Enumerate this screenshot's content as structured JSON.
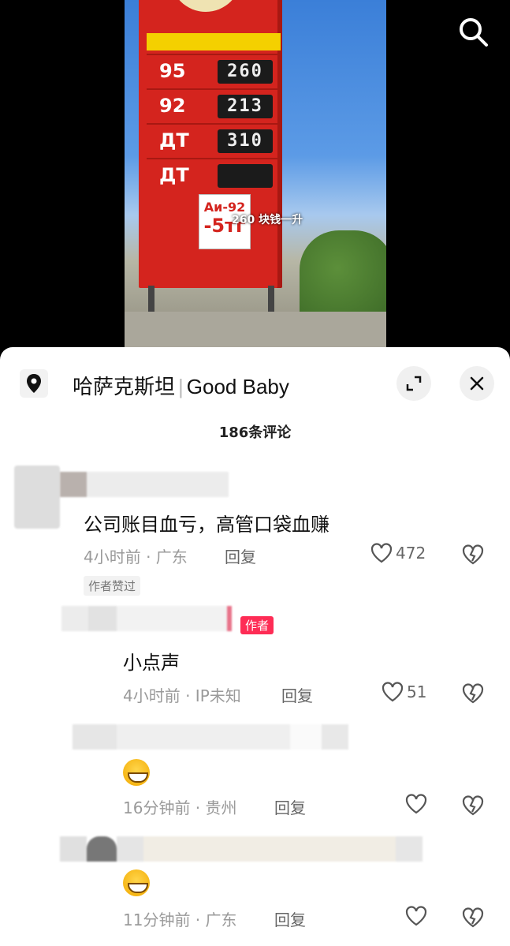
{
  "video": {
    "fuel_rows": [
      {
        "grade": "95",
        "price": "260"
      },
      {
        "grade": "92",
        "price": "213"
      },
      {
        "grade": "ДТ",
        "price": "310"
      },
      {
        "grade": "ДТ",
        "price": ""
      }
    ],
    "sign_line1": "Аи-92",
    "sign_line2": "-5тг",
    "caption": "260 块钱一升"
  },
  "header": {
    "location": "哈萨克斯坦",
    "music": "Good Baby",
    "comment_count": "186条评论"
  },
  "comments": [
    {
      "text": "公司账目血亏，高管口袋血赚",
      "meta": "4小时前 · 广东",
      "reply": "回复",
      "likes": "472",
      "tag": "作者赞过"
    },
    {
      "text": "小点声",
      "meta": "4小时前 · IP未知",
      "reply": "回复",
      "likes": "51",
      "author_tag": "作者"
    },
    {
      "text": "",
      "meta": "16分钟前 · 贵州",
      "reply": "回复",
      "likes": ""
    },
    {
      "text": "",
      "meta": "11分钟前 · 广东",
      "reply": "回复",
      "likes": ""
    }
  ]
}
